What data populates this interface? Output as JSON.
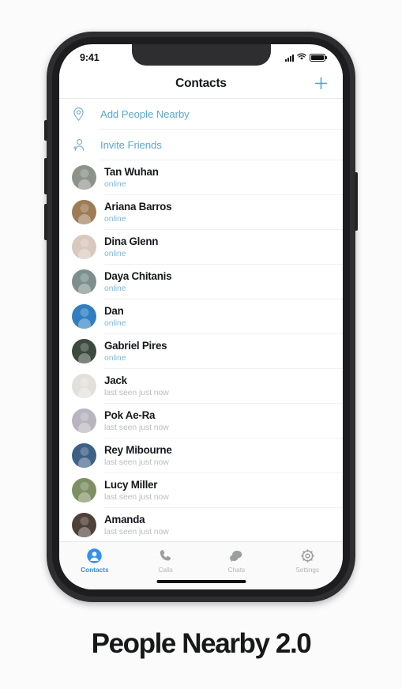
{
  "caption": "People Nearby 2.0",
  "colors": {
    "accent": "#3390ec",
    "link": "#5aa7cf",
    "online": "#81b8d8",
    "offline": "#b9bcc0",
    "text": "#16181c",
    "frame": "#2e2e30"
  },
  "status_bar": {
    "time": "9:41",
    "signal_icon": "signal-bars-icon",
    "wifi_icon": "wifi-icon",
    "battery_icon": "battery-full-icon"
  },
  "header": {
    "title": "Contacts",
    "add_icon": "plus-icon"
  },
  "actions": [
    {
      "label": "Add People Nearby",
      "icon": "map-pin-icon"
    },
    {
      "label": "Invite Friends",
      "icon": "person-add-icon"
    }
  ],
  "contacts": [
    {
      "name": "Tan Wuhan",
      "status": "online",
      "state": "online",
      "avatar_color": "#8c9388"
    },
    {
      "name": "Ariana Barros",
      "status": "online",
      "state": "online",
      "avatar_color": "#9d7c56"
    },
    {
      "name": "Dina Glenn",
      "status": "online",
      "state": "online",
      "avatar_color": "#d8c8bd"
    },
    {
      "name": "Daya Chitanis",
      "status": "online",
      "state": "online",
      "avatar_color": "#7d8f8c"
    },
    {
      "name": "Dan",
      "status": "online",
      "state": "online",
      "avatar_color": "#2f7fc0"
    },
    {
      "name": "Gabriel Pires",
      "status": "online",
      "state": "online",
      "avatar_color": "#3c4a3e"
    },
    {
      "name": "Jack",
      "status": "last seen just now",
      "state": "offline",
      "avatar_color": "#e3e0dc"
    },
    {
      "name": "Pok Ae-Ra",
      "status": "last seen just now",
      "state": "offline",
      "avatar_color": "#b9b4bf"
    },
    {
      "name": "Rey Mibourne",
      "status": "last seen just now",
      "state": "offline",
      "avatar_color": "#3e5f86"
    },
    {
      "name": "Lucy Miller",
      "status": "last seen just now",
      "state": "offline",
      "avatar_color": "#7d8f63"
    },
    {
      "name": "Amanda",
      "status": "last seen just now",
      "state": "offline",
      "avatar_color": "#4f4038"
    }
  ],
  "tabs": [
    {
      "label": "Contacts",
      "icon": "person-filled-icon",
      "active": true
    },
    {
      "label": "Calls",
      "icon": "phone-icon",
      "active": false
    },
    {
      "label": "Chats",
      "icon": "chat-bubbles-icon",
      "active": false
    },
    {
      "label": "Settings",
      "icon": "gear-icon",
      "active": false
    }
  ]
}
